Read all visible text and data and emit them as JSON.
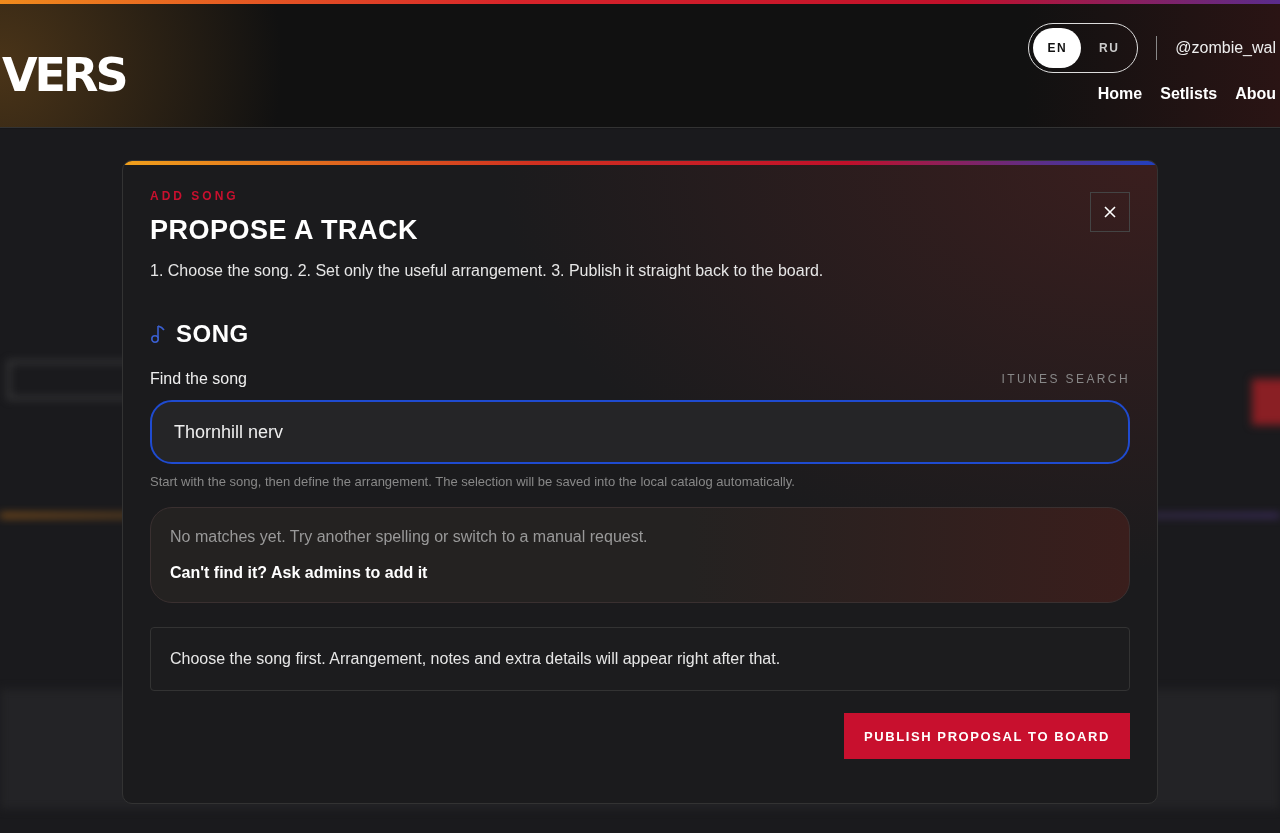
{
  "header": {
    "logo": "VERS",
    "languages": [
      {
        "label": "EN",
        "selected": true
      },
      {
        "label": "RU",
        "selected": false
      }
    ],
    "user": "@zombie_wal",
    "nav": [
      "Home",
      "Setlists",
      "Abou"
    ]
  },
  "modal": {
    "eyebrow": "ADD SONG",
    "title": "PROPOSE A TRACK",
    "steps": "1. Choose the song. 2. Set only the useful arrangement. 3. Publish it straight back to the board.",
    "section": {
      "title": "SONG",
      "field_label": "Find the song",
      "source": "ITUNES SEARCH",
      "value": "Thornhill nerv",
      "hint": "Start with the song, then define the arrangement. The selection will be saved into the local catalog automatically."
    },
    "empty": {
      "message": "No matches yet. Try another spelling or switch to a manual request.",
      "link": "Can't find it? Ask admins to add it"
    },
    "notice": "Choose the song first. Arrangement, notes and extra details will appear right after that.",
    "submit": "PUBLISH PROPOSAL TO BOARD"
  }
}
